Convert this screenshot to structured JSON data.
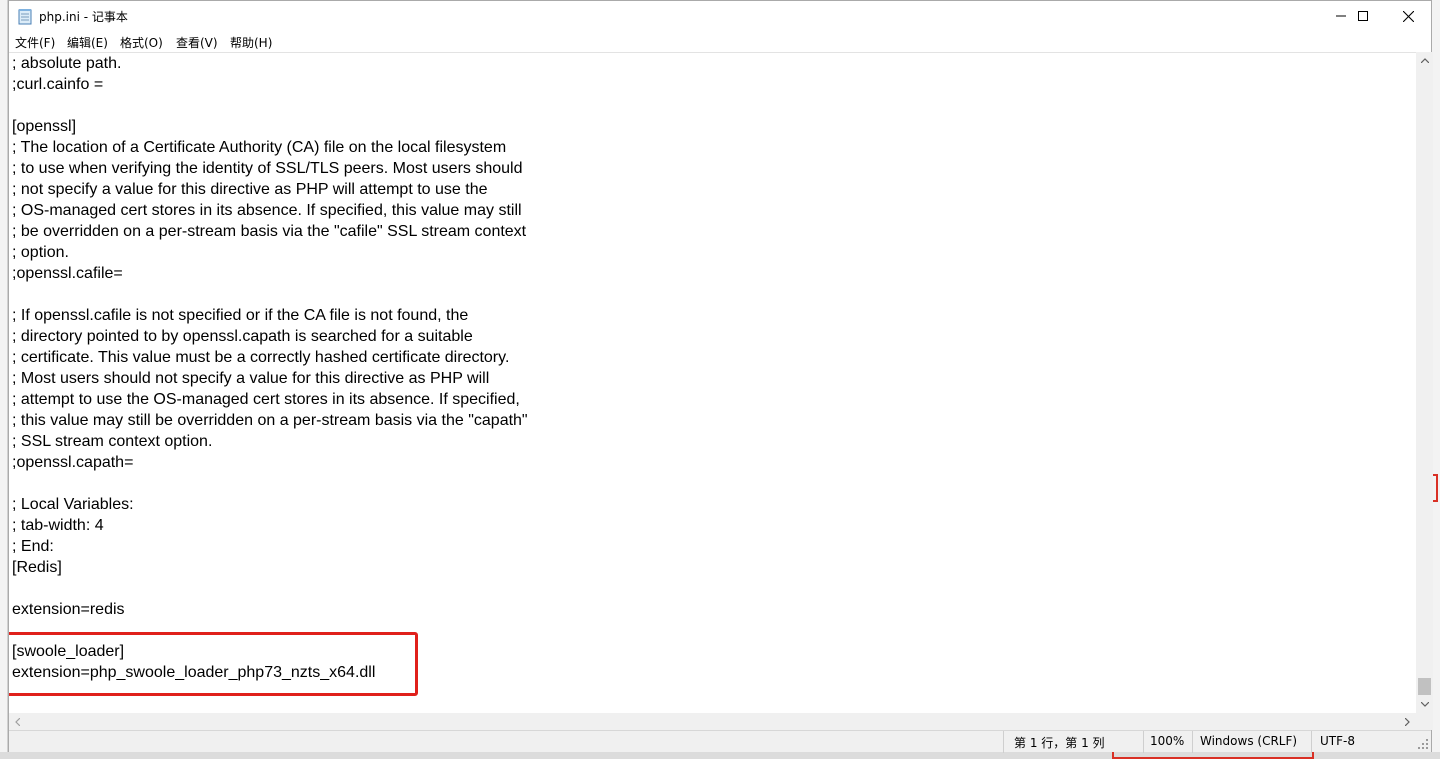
{
  "window": {
    "title": "php.ini - 记事本",
    "controls": {
      "minimize": "minimize",
      "maximize": "maximize",
      "close": "close"
    }
  },
  "menu": {
    "file": "文件(F)",
    "edit": "编辑(E)",
    "format": "格式(O)",
    "view": "查看(V)",
    "help": "帮助(H)"
  },
  "editor": {
    "lines": [
      "; absolute path.",
      ";curl.cainfo =",
      "",
      "[openssl]",
      "; The location of a Certificate Authority (CA) file on the local filesystem",
      "; to use when verifying the identity of SSL/TLS peers. Most users should",
      "; not specify a value for this directive as PHP will attempt to use the",
      "; OS-managed cert stores in its absence. If specified, this value may still",
      "; be overridden on a per-stream basis via the \"cafile\" SSL stream context",
      "; option.",
      ";openssl.cafile=",
      "",
      "; If openssl.cafile is not specified or if the CA file is not found, the",
      "; directory pointed to by openssl.capath is searched for a suitable",
      "; certificate. This value must be a correctly hashed certificate directory.",
      "; Most users should not specify a value for this directive as PHP will",
      "; attempt to use the OS-managed cert stores in its absence. If specified,",
      "; this value may still be overridden on a per-stream basis via the \"capath\"",
      "; SSL stream context option.",
      ";openssl.capath=",
      "",
      "; Local Variables:",
      "; tab-width: 4",
      "; End:",
      "[Redis]",
      "",
      "extension=redis",
      "",
      "[swoole_loader]",
      "extension=php_swoole_loader_php73_nzts_x64.dll"
    ],
    "highlight_color": "#e0201b"
  },
  "status": {
    "position": "第 1 行，第 1 列",
    "zoom": "100%",
    "line_ending": "Windows (CRLF)",
    "encoding": "UTF-8"
  },
  "icons": {
    "app": "notepad-icon",
    "scroll_up": "arrow-up-icon",
    "scroll_down": "arrow-down-icon",
    "scroll_left": "arrow-left-icon",
    "scroll_right": "arrow-right-icon",
    "grip": "resize-grip-icon"
  }
}
